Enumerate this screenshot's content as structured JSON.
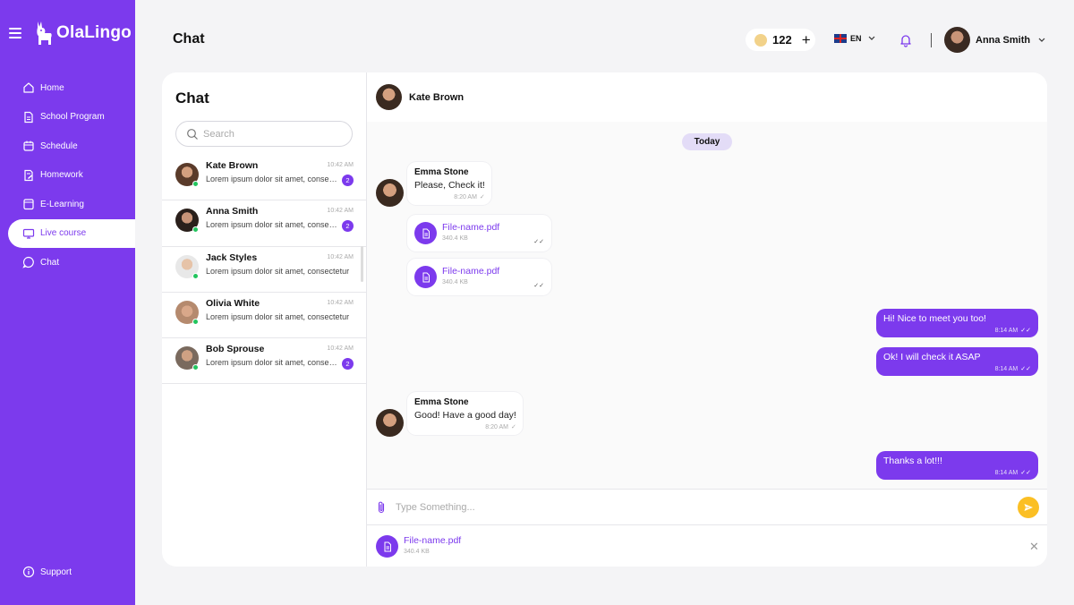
{
  "app": {
    "name": "OlaLingo"
  },
  "sidebar": {
    "items": [
      {
        "label": "Home",
        "icon": "home-icon"
      },
      {
        "label": "School Program",
        "icon": "document-icon"
      },
      {
        "label": "Schedule",
        "icon": "calendar-icon"
      },
      {
        "label": "Homework",
        "icon": "edit-document-icon"
      },
      {
        "label": "E-Learning",
        "icon": "folder-icon"
      },
      {
        "label": "Live course",
        "icon": "monitor-icon",
        "active": true
      },
      {
        "label": "Chat",
        "icon": "chat-icon"
      }
    ],
    "support": "Support"
  },
  "header": {
    "title": "Chat",
    "coins": "122",
    "plus": "+",
    "language": "EN",
    "user_name": "Anna Smith"
  },
  "chat_list": {
    "title": "Chat",
    "search_placeholder": "Search",
    "items": [
      {
        "name": "Kate Brown",
        "time": "10:42 AM",
        "preview": "Lorem ipsum dolor sit amet, consectetur",
        "unread": "2"
      },
      {
        "name": "Anna Smith",
        "time": "10:42 AM",
        "preview": "Lorem ipsum dolor sit amet, consectetur",
        "unread": "2"
      },
      {
        "name": "Jack Styles",
        "time": "10:42 AM",
        "preview": "Lorem ipsum dolor sit amet, consectetur",
        "unread": ""
      },
      {
        "name": "Olivia White",
        "time": "10:42 AM",
        "preview": "Lorem ipsum dolor sit amet, consectetur",
        "unread": ""
      },
      {
        "name": "Bob Sprouse",
        "time": "10:42 AM",
        "preview": "Lorem ipsum dolor sit amet, consectetur",
        "unread": "2"
      }
    ]
  },
  "conversation": {
    "contact_name": "Kate Brown",
    "date_divider": "Today",
    "messages": [
      {
        "sender": "Emma Stone",
        "text": "Please, Check it!",
        "time": "8:20 AM"
      },
      {
        "file_name": "File-name.pdf",
        "file_size": "340.4 KB"
      },
      {
        "file_name": "File-name.pdf",
        "file_size": "340.4 KB"
      },
      {
        "text": "Hi! Nice to meet you too!",
        "time": "8:14 AM"
      },
      {
        "text": "Ok! I will check it ASAP",
        "time": "8:14 AM"
      },
      {
        "sender": "Emma Stone",
        "text": "Good! Have a good day!",
        "time": "8:20 AM"
      },
      {
        "text": "Thanks a lot!!!",
        "time": "8:14 AM"
      }
    ],
    "composer_placeholder": "Type Something...",
    "pending_file": {
      "name": "File-name.pdf",
      "size": "340.4 KB"
    }
  },
  "colors": {
    "accent": "#7c3aed",
    "send": "#fbbf24",
    "online": "#22c55e"
  }
}
